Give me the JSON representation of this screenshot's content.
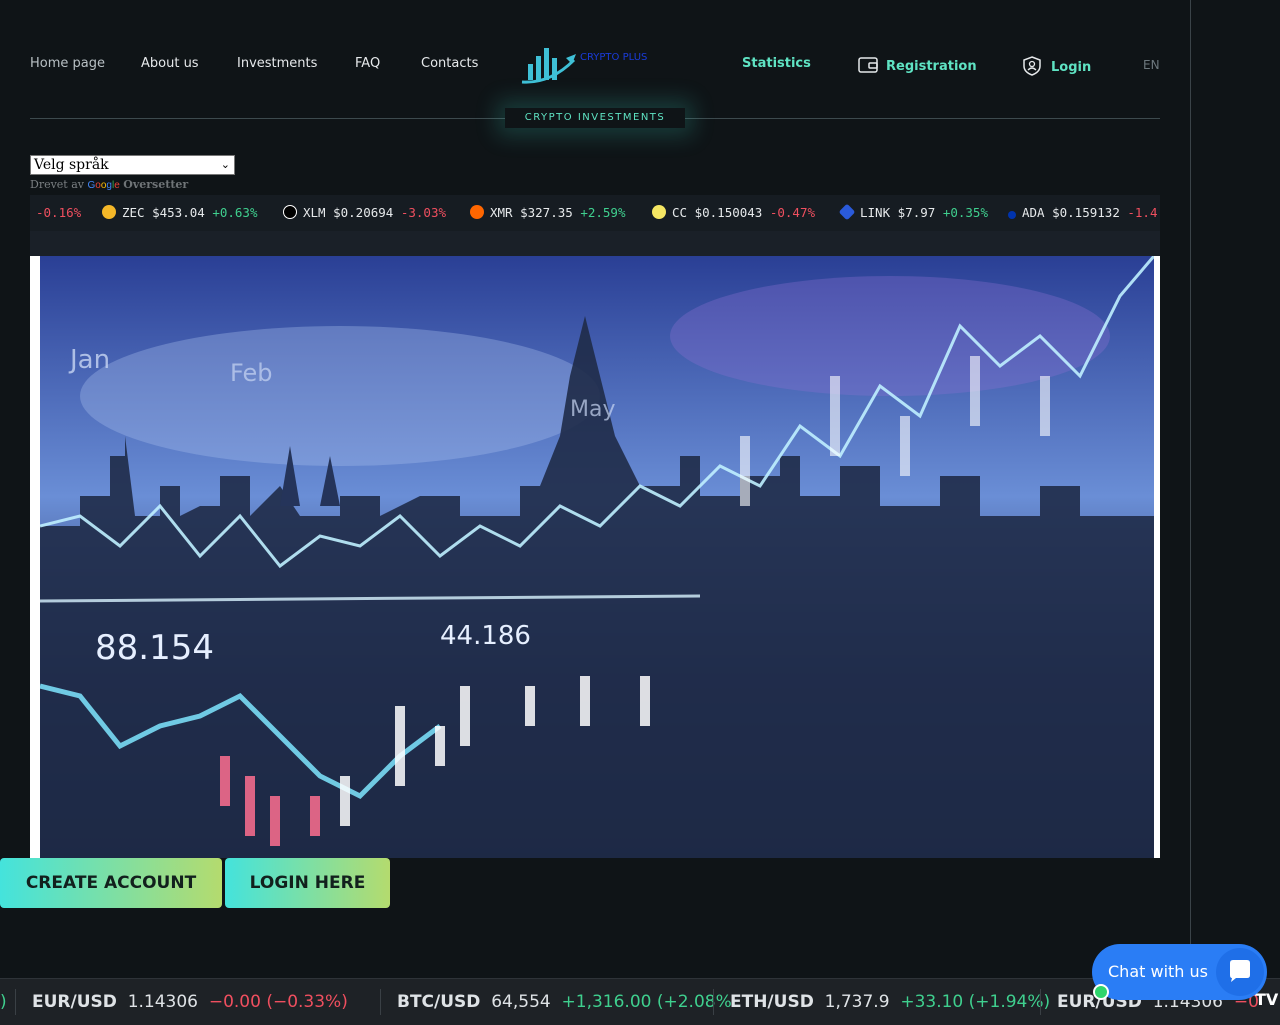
{
  "nav": {
    "items": [
      "Home page",
      "About us",
      "Investments",
      "FAQ",
      "Contacts"
    ],
    "statistics": "Statistics",
    "registration": "Registration",
    "login": "Login",
    "language": "EN"
  },
  "logo": {
    "brand": "CRYPTO PLUS"
  },
  "tagline": "CRYPTO INVESTMENTS",
  "translate": {
    "select_value": "Velg språk",
    "powered_by": "Drevet av",
    "google": "Google",
    "translate_label": "Oversetter"
  },
  "coin_ticker": [
    {
      "symbol": "",
      "price": "",
      "change": "-0.16%",
      "dir": "down",
      "icon": "none",
      "color": ""
    },
    {
      "symbol": "ZEC",
      "price": "$453.04",
      "change": "+0.63%",
      "dir": "up",
      "icon": "zcash-icon",
      "color": "#f4b728"
    },
    {
      "symbol": "XLM",
      "price": "$0.20694",
      "change": "-3.03%",
      "dir": "down",
      "icon": "stellar-icon",
      "color": "#ffffff"
    },
    {
      "symbol": "XMR",
      "price": "$327.35",
      "change": "+2.59%",
      "dir": "up",
      "icon": "monero-icon",
      "color": "#ff6600"
    },
    {
      "symbol": "CC",
      "price": "$0.150043",
      "change": "-0.47%",
      "dir": "down",
      "icon": "cc-icon",
      "color": "#f5e663"
    },
    {
      "symbol": "LINK",
      "price": "$7.97",
      "change": "+0.35%",
      "dir": "up",
      "icon": "chainlink-icon",
      "color": "#2a5ada"
    },
    {
      "symbol": "ADA",
      "price": "$0.159132",
      "change": "-1.4",
      "dir": "down",
      "icon": "cardano-icon",
      "color": "#0033ad"
    }
  ],
  "hero": {
    "label_jan": "Jan",
    "label_feb": "Feb",
    "label_may": "May",
    "value_1": "88.154",
    "value_2": "44.186"
  },
  "buttons": {
    "create_account": "CREATE ACCOUNT",
    "login_here": "LOGIN HERE"
  },
  "market_ticker": [
    {
      "symbol": "",
      "price": "",
      "change": ")",
      "dir": "up"
    },
    {
      "symbol": "EUR/USD",
      "price": "1.14306",
      "change": "−0.00 (−0.33%)",
      "dir": "down"
    },
    {
      "symbol": "BTC/USD",
      "price": "64,554",
      "change": "+1,316.00 (+2.08%",
      "dir": "up"
    },
    {
      "symbol": "ETH/USD",
      "price": "1,737.9",
      "change": "+33.10 (+1.94%)",
      "dir": "up"
    },
    {
      "symbol": "EUR/USD",
      "price": "1.14306",
      "change": "−0",
      "dir": "down"
    }
  ],
  "chat": {
    "label": "Chat with us"
  },
  "tradingview": "TV",
  "colors": {
    "accent": "#5fe3c3",
    "background": "#0f1417",
    "chat": "#2a7df5"
  }
}
